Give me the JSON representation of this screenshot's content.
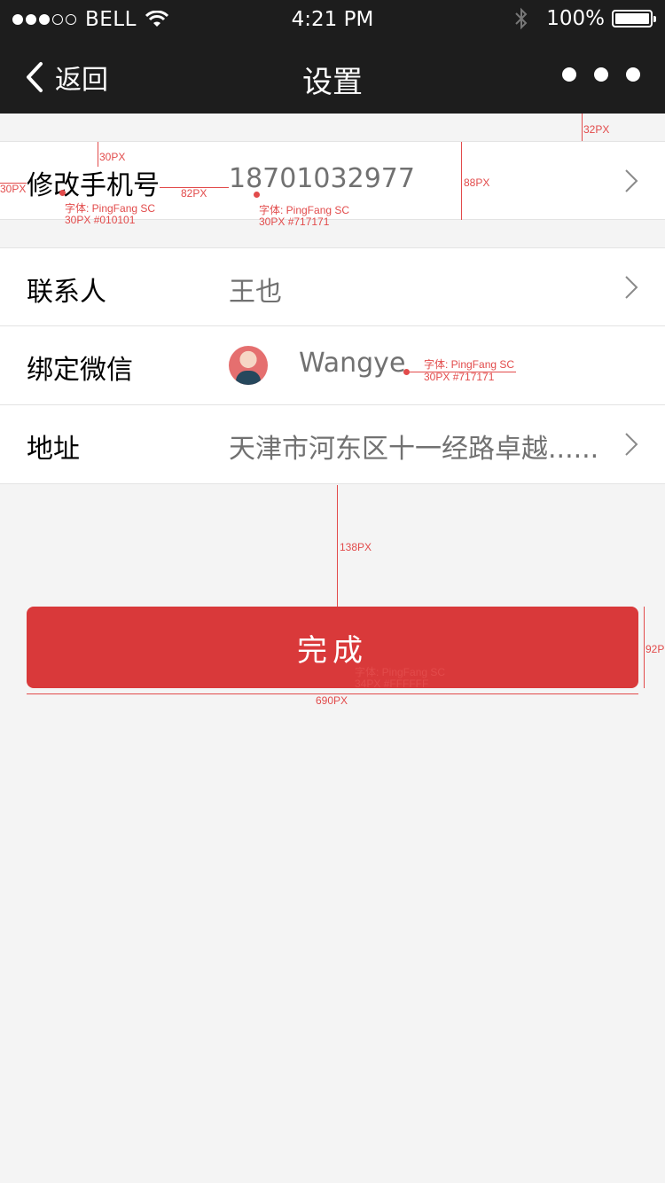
{
  "status_bar": {
    "carrier": "BELL",
    "time": "4:21 PM",
    "battery": "100%",
    "signal_bars": 3,
    "signal_total": 5,
    "battery_level": 1.0
  },
  "nav": {
    "back_label": "返回",
    "title": "设置"
  },
  "rows": [
    {
      "label": "修改手机号",
      "value": "18701032977"
    },
    {
      "label": "联系人",
      "value": "王也"
    },
    {
      "label": "绑定微信",
      "value": "Wangye"
    },
    {
      "label": "地址",
      "value": "天津市河东区十一经路卓越......"
    }
  ],
  "done_button": {
    "label": "完成"
  },
  "annotations": {
    "a32": "32PX",
    "a30top": "30PX",
    "a30left": "30PX",
    "a82": "82PX",
    "a88": "88PX",
    "font_label": "字体: PingFang SC",
    "font_label_size": "30PX #010101",
    "font_value": "字体: PingFang SC",
    "font_value_size": "30PX #717171",
    "font_wechat": "字体: PingFang SC",
    "font_wechat_size": "30PX #717171",
    "a138": "138PX",
    "a92": "92P",
    "font_button": "字体: PingFang SC",
    "font_button_size": "34PX #FFFFFF",
    "a690": "690PX"
  },
  "colors": {
    "nav_bg": "#1d1d1d",
    "accent": "#d9393a",
    "label_color": "#010101",
    "value_color": "#717171",
    "annotation": "#e24b4b"
  }
}
